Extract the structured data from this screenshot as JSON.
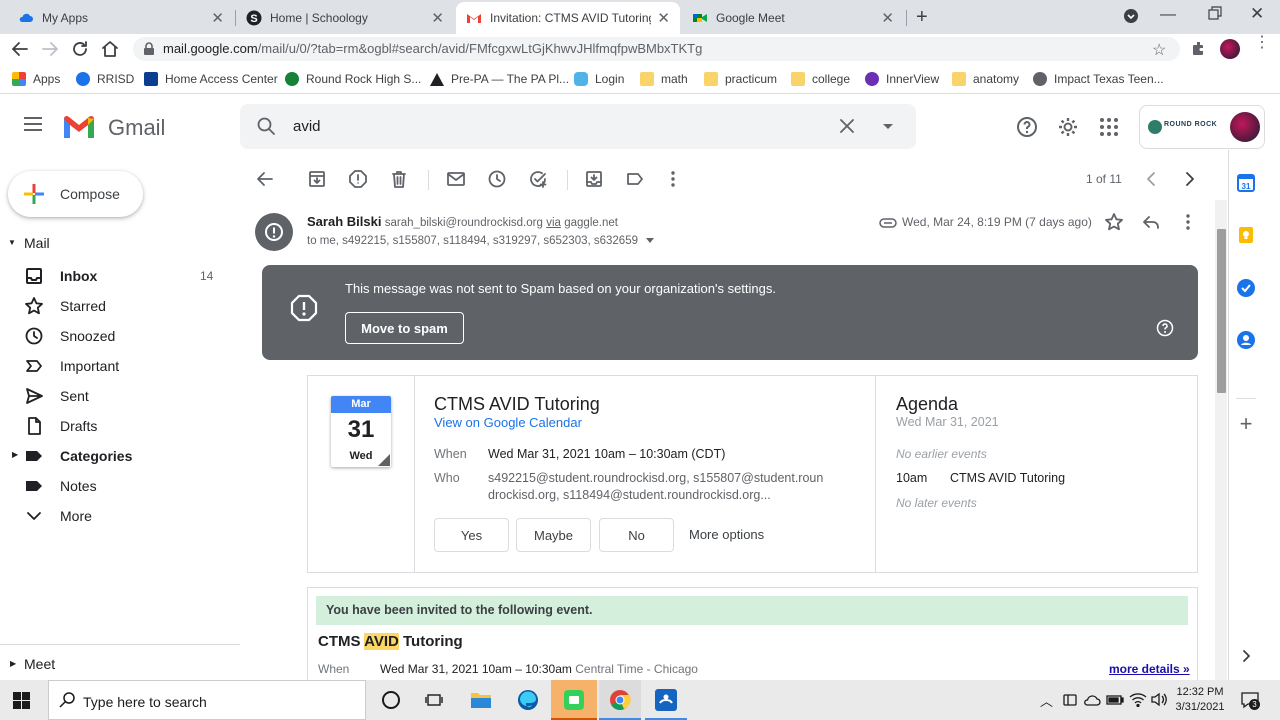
{
  "browser": {
    "tabs": [
      {
        "title": "My Apps",
        "favicon": "cloud-icon",
        "color": "#1a73e8"
      },
      {
        "title": "Home | Schoology",
        "favicon": "schoology-icon",
        "color": "#202124"
      },
      {
        "title": "Invitation: CTMS AVID Tutoring @",
        "favicon": "gmail-icon",
        "color": "#ea4335"
      },
      {
        "title": "Google Meet",
        "favicon": "meet-icon",
        "color": "#00832d"
      }
    ],
    "url_host": "mail.google.com",
    "url_path": "/mail/u/0/?tab=rm&ogbl#search/avid/FMfcgxwLtGjKhwvJHlfmqfpwBMbxTKTg",
    "bookmarks": [
      {
        "label": "Apps",
        "color": "#4285f4"
      },
      {
        "label": "RRISD",
        "color": "#1a73e8"
      },
      {
        "label": "Home Access Center",
        "color": "#0b3d91"
      },
      {
        "label": "Round Rock High S...",
        "color": "#188038"
      },
      {
        "label": "Pre-PA — The PA Pl...",
        "color": "#202124"
      },
      {
        "label": "Login",
        "color": "#4fb3e8"
      },
      {
        "label": "math",
        "color": "#f9d46b"
      },
      {
        "label": "practicum",
        "color": "#f9d46b"
      },
      {
        "label": "college",
        "color": "#f9d46b"
      },
      {
        "label": "InnerView",
        "color": "#6b2fb3"
      },
      {
        "label": "anatomy",
        "color": "#f9d46b"
      },
      {
        "label": "Impact Texas Teen...",
        "color": "#5f6368"
      }
    ]
  },
  "gmail": {
    "logo_text": "Gmail",
    "search_value": "avid",
    "account_label": "ROUND ROCK",
    "compose_label": "Compose",
    "mail_section": "Mail",
    "meet_section": "Meet",
    "nav": [
      {
        "label": "Inbox",
        "count": "14",
        "icon": "inbox-icon",
        "bold": true
      },
      {
        "label": "Starred",
        "count": "",
        "icon": "star-icon"
      },
      {
        "label": "Snoozed",
        "count": "",
        "icon": "clock-icon"
      },
      {
        "label": "Important",
        "count": "",
        "icon": "important-icon"
      },
      {
        "label": "Sent",
        "count": "",
        "icon": "send-icon"
      },
      {
        "label": "Drafts",
        "count": "",
        "icon": "draft-icon"
      },
      {
        "label": "Categories",
        "count": "",
        "icon": "label-icon",
        "bold": true
      },
      {
        "label": "Notes",
        "count": "",
        "icon": "label-icon"
      },
      {
        "label": "More",
        "count": "",
        "icon": "chevron-down-icon"
      }
    ],
    "pagination": "1 of 11"
  },
  "message": {
    "sender_name": "Sarah Bilski",
    "sender_email": "sarah_bilski@roundrockisd.org",
    "via_text": "via",
    "via_domain": "gaggle.net",
    "date": "Wed, Mar 24, 8:19 PM (7 days ago)",
    "to_line": "to me, s492215, s155807, s118494, s319297, s652303, s632659",
    "spam_notice": "This message was not sent to Spam based on your organization's settings.",
    "move_to_spam": "Move to spam"
  },
  "event_card": {
    "month": "Mar",
    "day": "31",
    "weekday": "Wed",
    "title": "CTMS AVID Tutoring",
    "calendar_link": "View on Google Calendar",
    "when_label": "When",
    "when_value": "Wed Mar 31, 2021 10am – 10:30am (CDT)",
    "who_label": "Who",
    "who_value_1": "s492215@student.roundrockisd.org, s155807@student.roun",
    "who_value_2": "drockisd.org, s118494@student.roundrockisd.org...",
    "buttons": [
      "Yes",
      "Maybe",
      "No"
    ],
    "more_options": "More options",
    "agenda_title": "Agenda",
    "agenda_date": "Wed Mar 31, 2021",
    "no_earlier": "No earlier events",
    "agenda_time": "10am",
    "agenda_event": "CTMS AVID Tutoring",
    "no_later": "No later events"
  },
  "invite_body": {
    "banner": "You have been invited to the following event.",
    "title_pre": "CTMS ",
    "title_highlight": "AVID",
    "title_post": " Tutoring",
    "when_label": "When",
    "when_value": "Wed Mar 31, 2021 10am – 10:30am",
    "timezone": "Central Time - Chicago",
    "more_details": "more details »"
  },
  "taskbar": {
    "search_placeholder": "Type here to search",
    "time": "12:32 PM",
    "date": "3/31/2021",
    "notification_count": "3"
  },
  "colors": {
    "gmail_red": "#ea4335",
    "link_blue": "#1a0dab",
    "banner_green": "#d4efdc",
    "spam_banner": "#5f6368"
  }
}
